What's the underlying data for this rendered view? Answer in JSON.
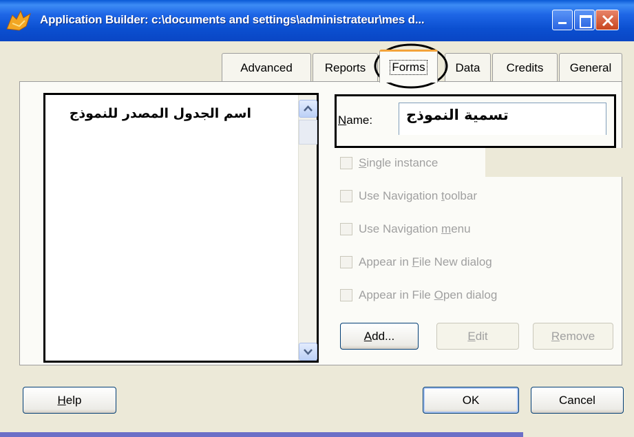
{
  "window": {
    "title": "Application Builder: c:\\documents and settings\\administrateur\\mes d...",
    "icon": "fox-app-icon",
    "controls": [
      "minimize-icon",
      "maximize-icon",
      "close-icon"
    ]
  },
  "tabs": [
    {
      "label": "Advanced"
    },
    {
      "label": "Reports"
    },
    {
      "label": "Forms",
      "active": true
    },
    {
      "label": "Data"
    },
    {
      "label": "Credits"
    },
    {
      "label": "General"
    }
  ],
  "forms_list": {
    "items": [
      "اسم الجدول المصدر للنموذج"
    ]
  },
  "name_field": {
    "label": "Name:",
    "value": "تسمية النموذج"
  },
  "options": [
    {
      "pre": "",
      "u": "S",
      "post": "ingle instance",
      "checked": false,
      "enabled": false
    },
    {
      "pre": "Use Navigation ",
      "u": "t",
      "post": "oolbar",
      "checked": false,
      "enabled": false
    },
    {
      "pre": "Use Navigation ",
      "u": "m",
      "post": "enu",
      "checked": false,
      "enabled": false
    },
    {
      "pre": "Appear in ",
      "u": "F",
      "post": "ile New dialog",
      "checked": false,
      "enabled": false
    },
    {
      "pre": "Appear in File ",
      "u": "O",
      "post": "pen dialog",
      "checked": false,
      "enabled": false
    }
  ],
  "buttons": {
    "add": {
      "u": "A",
      "post": "dd..."
    },
    "edit": {
      "u": "E",
      "post": "dit"
    },
    "remove": {
      "u": "R",
      "post": "emove"
    },
    "help": {
      "u": "H",
      "post": "elp"
    },
    "ok": {
      "label": "OK"
    },
    "cancel": {
      "label": "Cancel"
    }
  },
  "colors": {
    "titlebar": "#0a5ad6",
    "face": "#ece9d8",
    "active_tab_accent": "#f3a33a",
    "annotation": "#000000"
  }
}
